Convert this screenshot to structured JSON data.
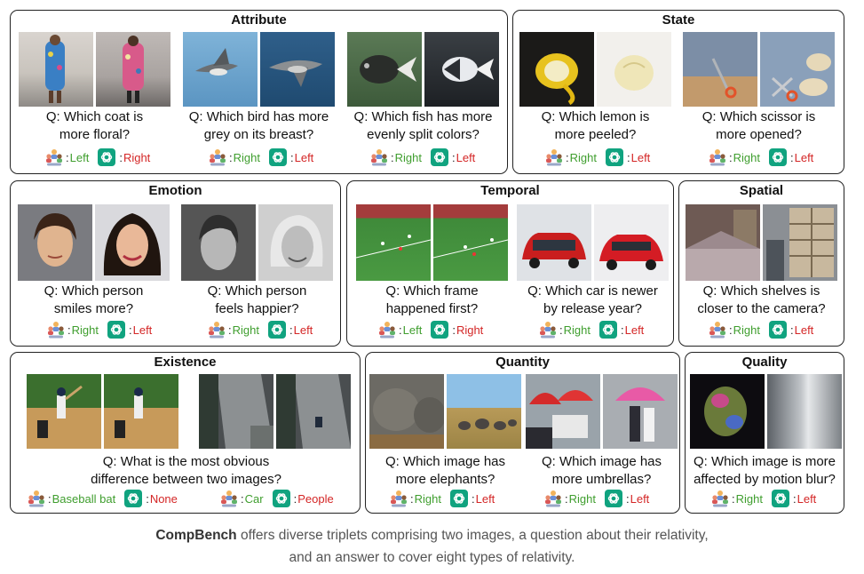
{
  "caption": {
    "brand": "CompBench",
    "line1_rest": " offers diverse triplets comprising two images, a question about their relativity,",
    "line2": "and an answer to cover eight types of relativity."
  },
  "panels": {
    "attribute": {
      "title": "Attribute",
      "items": [
        {
          "q1": "Q: Which coat is",
          "q2": "more floral?",
          "human": "Left",
          "gpt": "Right"
        },
        {
          "q1": "Q: Which bird has more",
          "q2": "grey on its breast?",
          "human": "Right",
          "gpt": "Left"
        },
        {
          "q1": "Q: Which fish has more",
          "q2": "evenly split colors?",
          "human": "Right",
          "gpt": "Left"
        }
      ]
    },
    "state": {
      "title": "State",
      "items": [
        {
          "q1": "Q: Which lemon is",
          "q2": "more peeled?",
          "human": "Right",
          "gpt": "Left"
        },
        {
          "q1": "Q: Which scissor is",
          "q2": "more opened?",
          "human": "Right",
          "gpt": "Left"
        }
      ]
    },
    "emotion": {
      "title": "Emotion",
      "items": [
        {
          "q1": "Q: Which person",
          "q2": "smiles more?",
          "human": "Right",
          "gpt": "Left"
        },
        {
          "q1": "Q: Which person",
          "q2": "feels happier?",
          "human": "Right",
          "gpt": "Left"
        }
      ]
    },
    "temporal": {
      "title": "Temporal",
      "items": [
        {
          "q1": "Q: Which frame",
          "q2": "happened first?",
          "human": "Left",
          "gpt": "Right"
        },
        {
          "q1": "Q: Which car is newer",
          "q2": "by release year?",
          "human": "Right",
          "gpt": "Left"
        }
      ]
    },
    "spatial": {
      "title": "Spatial",
      "items": [
        {
          "q1": "Q: Which shelves is",
          "q2": "closer to the camera?",
          "human": "Right",
          "gpt": "Left"
        }
      ]
    },
    "existence": {
      "title": "Existence",
      "q1": "Q: What is the most obvious",
      "q2": "difference between two images?",
      "answers": [
        {
          "human": "Baseball bat",
          "gpt": "None"
        },
        {
          "human": "Car",
          "gpt": "People"
        }
      ]
    },
    "quantity": {
      "title": "Quantity",
      "items": [
        {
          "q1": "Q: Which image has",
          "q2": "more elephants?",
          "human": "Right",
          "gpt": "Left"
        },
        {
          "q1": "Q: Which image has",
          "q2": "more umbrellas?",
          "human": "Right",
          "gpt": "Left"
        }
      ]
    },
    "quality": {
      "title": "Quality",
      "items": [
        {
          "q1": "Q: Which image is more",
          "q2": "affected by motion blur?",
          "human": "Right",
          "gpt": "Left"
        }
      ]
    }
  },
  "colors": {
    "human_answer": "#3f9e2e",
    "gpt_answer": "#d42626",
    "gpt_badge": "#10a37f"
  },
  "icons": {
    "human": "people-group-icon",
    "gpt": "chatgpt-logo-icon"
  }
}
